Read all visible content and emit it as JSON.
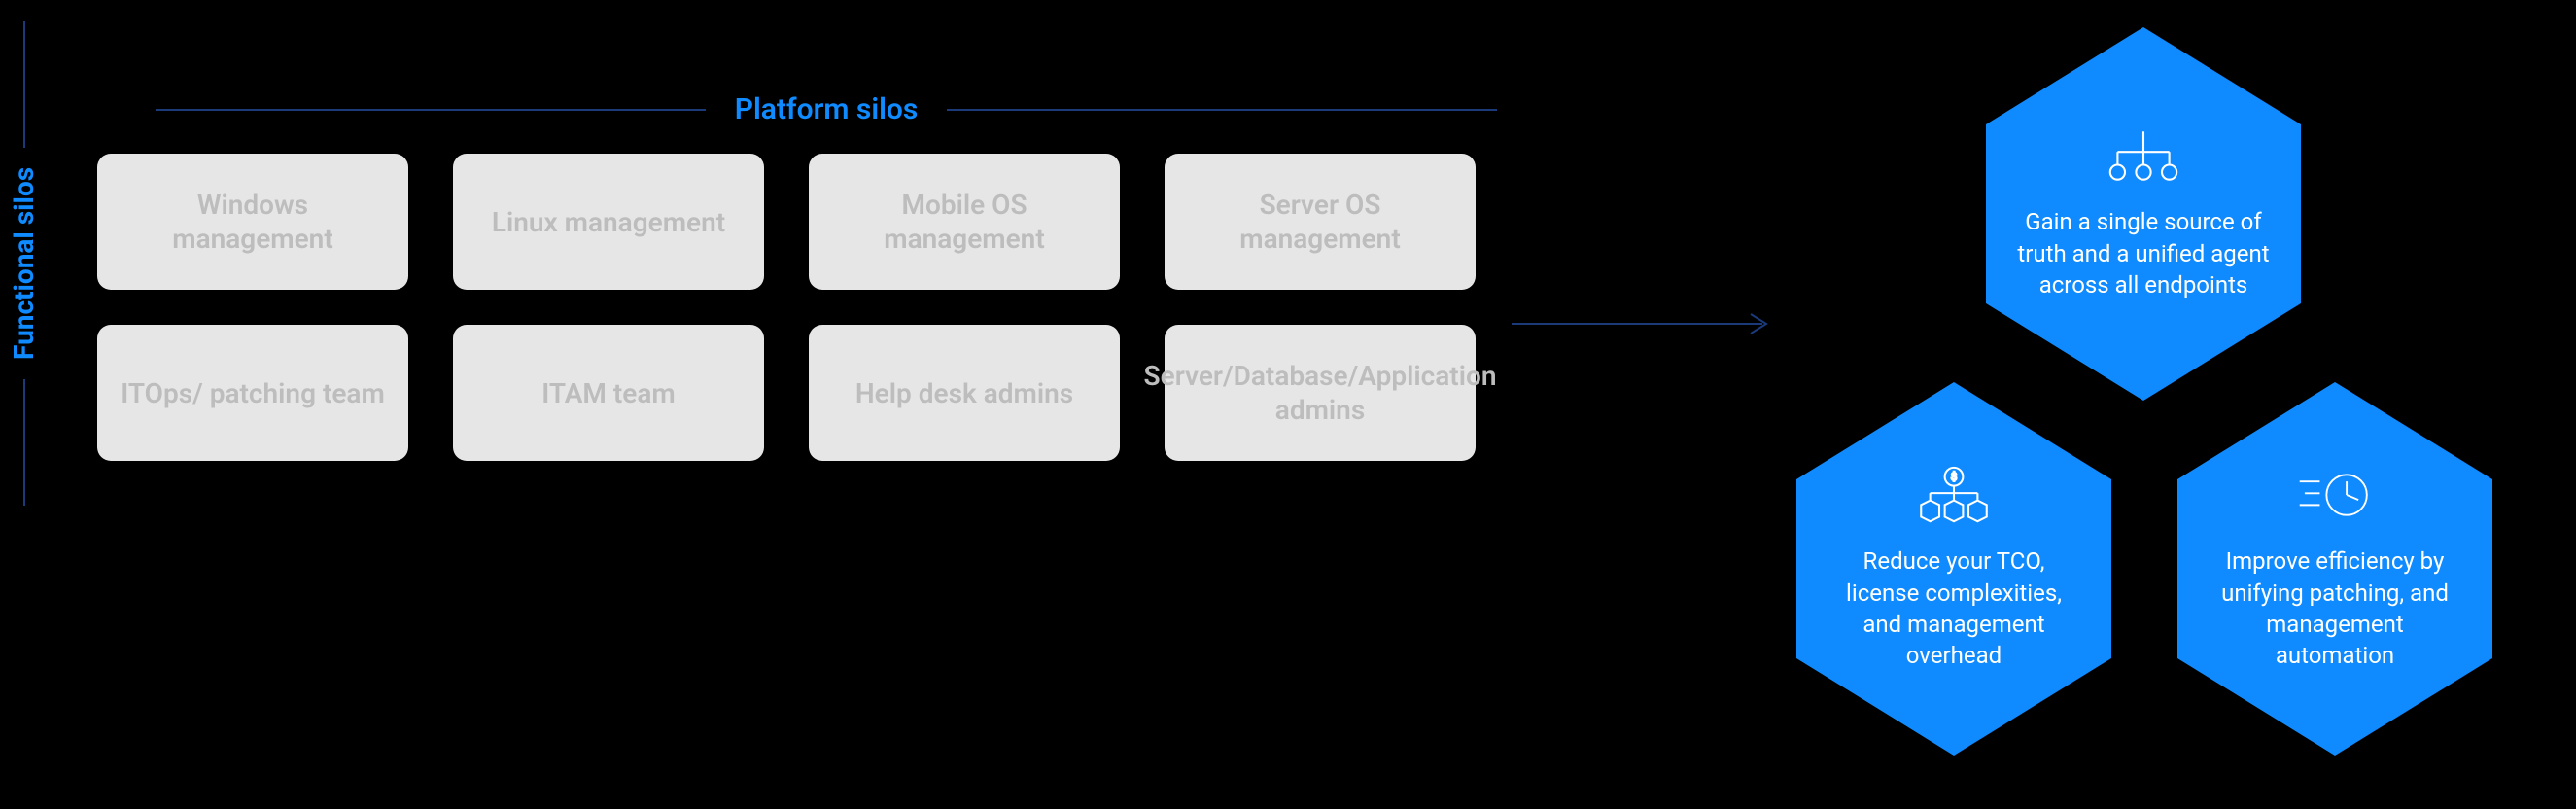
{
  "axes": {
    "x": "Platform silos",
    "y": "Functional silos"
  },
  "silos": {
    "row1": {
      "c0": "Windows management",
      "c1": "Linux management",
      "c2": "Mobile OS management",
      "c3": "Server OS management"
    },
    "row2": {
      "c0": "ITOps/ patching team",
      "c1": "ITAM team",
      "c2": "Help desk admins",
      "c3": "Server/Database/Application admins"
    }
  },
  "hex": {
    "top": {
      "icon": "org-hierarchy-icon",
      "text": "Gain a single source of truth and a unified agent across all endpoints"
    },
    "left": {
      "icon": "cost-boxes-icon",
      "text": "Reduce your TCO, license complexities, and management overhead"
    },
    "right": {
      "icon": "speed-clock-icon",
      "text": "Improve efficiency by unifying patching, and management automation"
    }
  }
}
